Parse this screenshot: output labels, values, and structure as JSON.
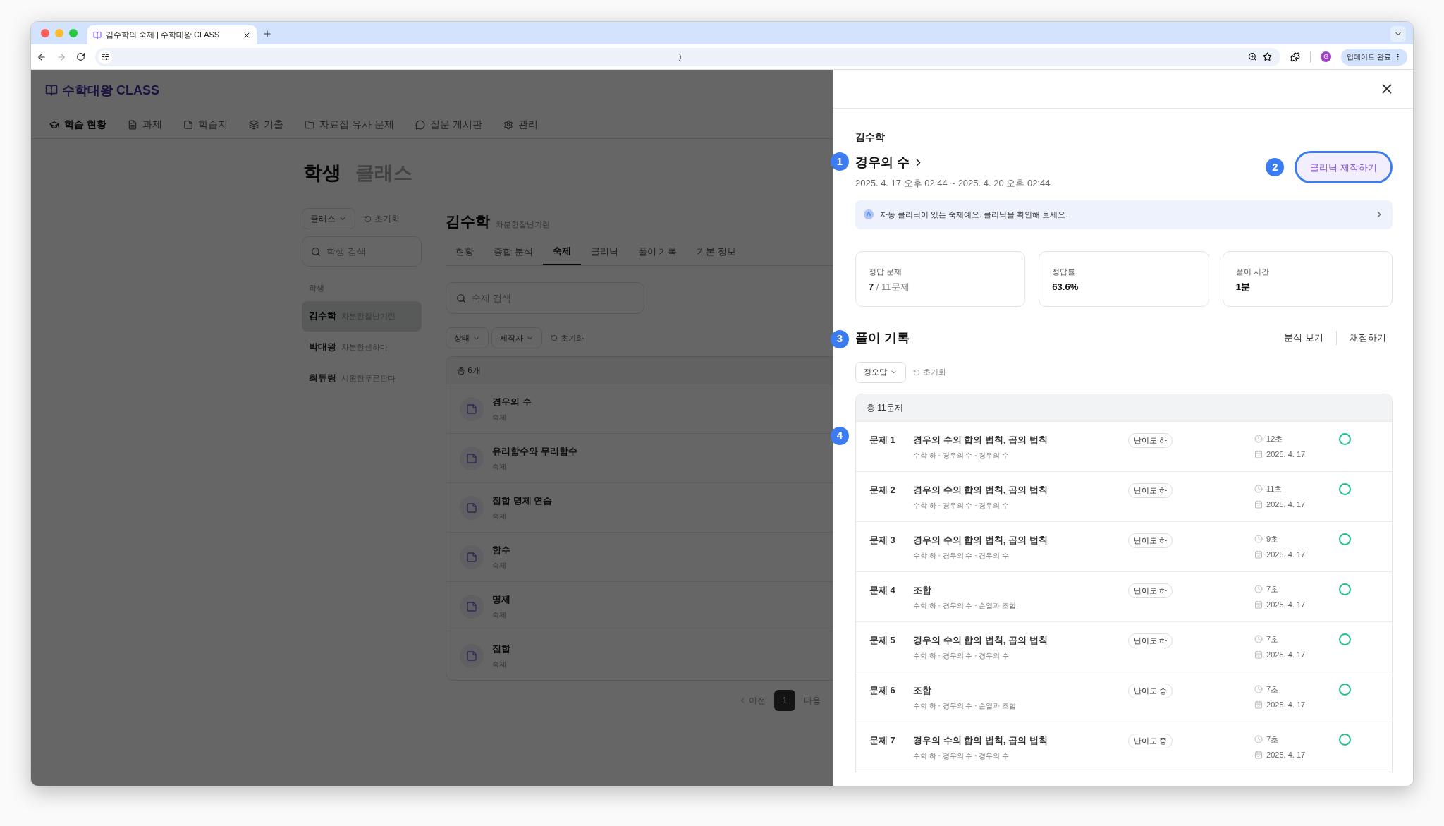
{
  "browser": {
    "tab_title": "김수학의 숙제 | 수학대왕 CLASS",
    "url": ")",
    "update_button": "업데이트 완료",
    "profile_initial": "G"
  },
  "app": {
    "logo": "수학대왕 CLASS",
    "nav": [
      {
        "label": "학습 현황",
        "selected": true
      },
      {
        "label": "과제",
        "selected": false
      },
      {
        "label": "학습지",
        "selected": false
      },
      {
        "label": "기출",
        "selected": false
      },
      {
        "label": "자료집 유사 문제",
        "selected": false
      },
      {
        "label": "질문 게시판",
        "selected": false
      },
      {
        "label": "관리",
        "selected": false
      }
    ],
    "page_tabs": [
      {
        "label": "학생",
        "selected": true
      },
      {
        "label": "클래스",
        "selected": false
      }
    ],
    "sidebar": {
      "class_filter": "클래스",
      "reset": "초기화",
      "search_placeholder": "학생 검색",
      "section_label": "학생",
      "students": [
        {
          "name": "김수학",
          "nickname": "차분한잘난기린",
          "selected": true
        },
        {
          "name": "박대왕",
          "nickname": "차분한센하마",
          "selected": false
        },
        {
          "name": "최튜링",
          "nickname": "시원한푸른판다",
          "selected": false
        }
      ]
    },
    "student": {
      "name": "김수학",
      "nickname": "차분한잘난기린",
      "tabs": [
        {
          "label": "현황",
          "selected": false
        },
        {
          "label": "종합 분석",
          "selected": false
        },
        {
          "label": "숙제",
          "selected": true
        },
        {
          "label": "클리닉",
          "selected": false
        },
        {
          "label": "풀이 기록",
          "selected": false
        },
        {
          "label": "기본 정보",
          "selected": false
        }
      ],
      "search_placeholder": "숙제 검색",
      "filters": [
        "상태",
        "제작자"
      ],
      "reset": "초기화",
      "total": "총 6개",
      "homework": [
        {
          "title": "경우의 수",
          "type": "숙제"
        },
        {
          "title": "유리함수와 무리함수",
          "type": "숙제"
        },
        {
          "title": "집합 명제 연습",
          "type": "숙제"
        },
        {
          "title": "함수",
          "type": "숙제"
        },
        {
          "title": "명제",
          "type": "숙제"
        },
        {
          "title": "집합",
          "type": "숙제"
        }
      ],
      "pagination": {
        "prev": "이전",
        "pages": [
          {
            "label": "1",
            "selected": true
          }
        ],
        "next": "다음"
      }
    }
  },
  "drawer": {
    "student": "김수학",
    "title": "경우의 수",
    "period": "2025. 4. 17 오후 02:44 ~ 2025. 4. 20 오후 02:44",
    "clinic_button": "클리닉 제작하기",
    "notice": {
      "badge": "A",
      "text": "자동 클리닉이 있는 숙제예요. 클리닉을 확인해 보세요."
    },
    "stats": [
      {
        "label": "정답 문제",
        "value": "7",
        "suffix": " / 11문제"
      },
      {
        "label": "정답률",
        "value": "63.6%"
      },
      {
        "label": "풀이 시간",
        "value": "1분"
      }
    ],
    "records": {
      "title": "풀이 기록",
      "actions": [
        "분석 보기",
        "채점하기"
      ],
      "filter": "정오답",
      "reset": "초기화",
      "total": "총 11문제",
      "rows": [
        {
          "number": "문제 1",
          "title": "경우의 수의 합의 법칙, 곱의 법칙",
          "path": "수학 하 · 경우의 수 · 경우의 수",
          "difficulty": "난이도 하",
          "time": "12초",
          "date": "2025. 4. 17",
          "correct": true
        },
        {
          "number": "문제 2",
          "title": "경우의 수의 합의 법칙, 곱의 법칙",
          "path": "수학 하 · 경우의 수 · 경우의 수",
          "difficulty": "난이도 하",
          "time": "11초",
          "date": "2025. 4. 17",
          "correct": true
        },
        {
          "number": "문제 3",
          "title": "경우의 수의 합의 법칙, 곱의 법칙",
          "path": "수학 하 · 경우의 수 · 경우의 수",
          "difficulty": "난이도 하",
          "time": "9초",
          "date": "2025. 4. 17",
          "correct": true
        },
        {
          "number": "문제 4",
          "title": "조합",
          "path": "수학 하 · 경우의 수 · 순열과 조합",
          "difficulty": "난이도 하",
          "time": "7초",
          "date": "2025. 4. 17",
          "correct": true
        },
        {
          "number": "문제 5",
          "title": "경우의 수의 합의 법칙, 곱의 법칙",
          "path": "수학 하 · 경우의 수 · 경우의 수",
          "difficulty": "난이도 하",
          "time": "7초",
          "date": "2025. 4. 17",
          "correct": true
        },
        {
          "number": "문제 6",
          "title": "조합",
          "path": "수학 하 · 경우의 수 · 순열과 조합",
          "difficulty": "난이도 중",
          "time": "7초",
          "date": "2025. 4. 17",
          "correct": true
        },
        {
          "number": "문제 7",
          "title": "경우의 수의 합의 법칙, 곱의 법칙",
          "path": "수학 하 · 경우의 수 · 경우의 수",
          "difficulty": "난이도 중",
          "time": "7초",
          "date": "2025. 4. 17",
          "correct": true
        }
      ]
    }
  },
  "markers": [
    "1",
    "2",
    "3",
    "4"
  ]
}
